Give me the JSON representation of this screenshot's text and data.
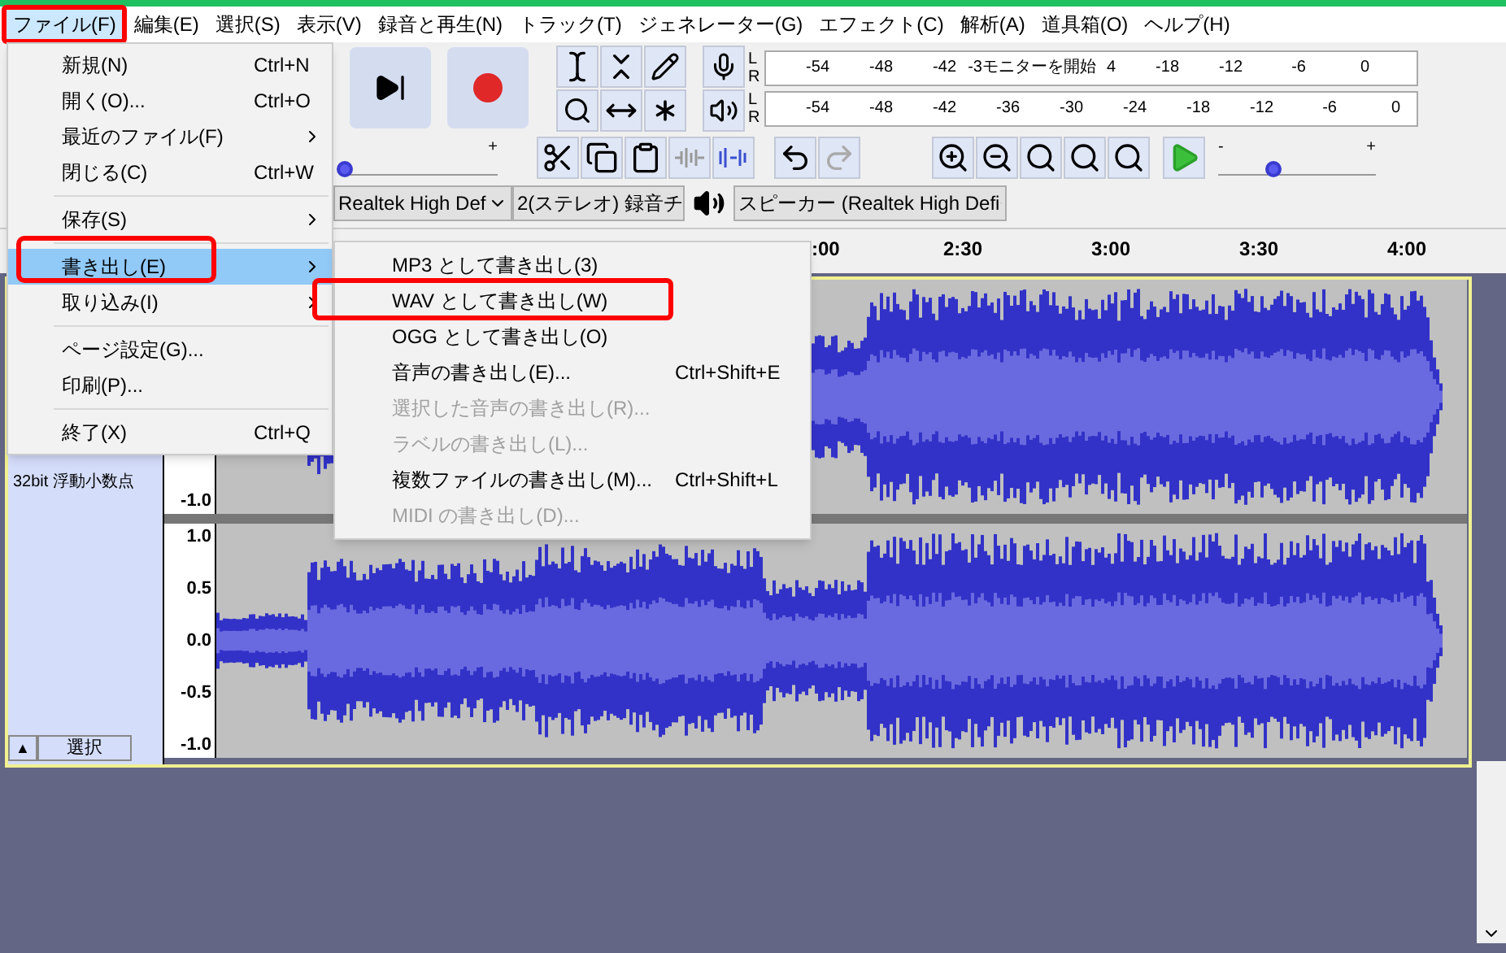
{
  "menubar": [
    {
      "label": "ファイル(F)",
      "selected": true,
      "annotated": true
    },
    {
      "label": "編集(E)",
      "selected": false,
      "annotated": false
    },
    {
      "label": "選択(S)",
      "selected": false,
      "annotated": false
    },
    {
      "label": "表示(V)",
      "selected": false,
      "annotated": false
    },
    {
      "label": "録音と再生(N)",
      "selected": false,
      "annotated": false
    },
    {
      "label": "トラック(T)",
      "selected": false,
      "annotated": false
    },
    {
      "label": "ジェネレーター(G)",
      "selected": false,
      "annotated": false
    },
    {
      "label": "エフェクト(C)",
      "selected": false,
      "annotated": false
    },
    {
      "label": "解析(A)",
      "selected": false,
      "annotated": false
    },
    {
      "label": "道具箱(O)",
      "selected": false,
      "annotated": false
    },
    {
      "label": "ヘルプ(H)",
      "selected": false,
      "annotated": false
    }
  ],
  "meters": [
    {
      "channels": [
        "L",
        "R"
      ],
      "ticks": [
        {
          "kind": "tick",
          "label": "-54"
        },
        {
          "kind": "tick",
          "label": "-48"
        },
        {
          "kind": "tick",
          "label": "-42"
        },
        {
          "kind": "stub",
          "label": "-3"
        },
        {
          "kind": "prompt",
          "label": "モニターを開始"
        },
        {
          "kind": "stub",
          "label": "4"
        },
        {
          "kind": "tick",
          "label": "-18"
        },
        {
          "kind": "tick",
          "label": "-12"
        },
        {
          "kind": "tick",
          "label": "-6"
        },
        {
          "kind": "tick",
          "label": "0"
        }
      ]
    },
    {
      "channels": [
        "L",
        "R"
      ],
      "ticks": [
        {
          "kind": "tick",
          "label": "-54"
        },
        {
          "kind": "tick",
          "label": "-48"
        },
        {
          "kind": "tick",
          "label": "-42"
        },
        {
          "kind": "tick",
          "label": "-36"
        },
        {
          "kind": "tick",
          "label": "-30"
        },
        {
          "kind": "tick",
          "label": "-24"
        },
        {
          "kind": "tick",
          "label": "-18"
        },
        {
          "kind": "tick",
          "label": "-12"
        },
        {
          "kind": "tick",
          "label": "-6"
        },
        {
          "kind": "tick",
          "label": "0"
        }
      ]
    }
  ],
  "volume_slider": {
    "plus": "+",
    "level": 0.03
  },
  "speed_slider": {
    "minus": "-",
    "plus": "+",
    "level": 0.35
  },
  "devices": {
    "host": "Realtek High Def",
    "channels": "2(ステレオ) 録音チ",
    "output": "スピーカー (Realtek High Defi"
  },
  "timeline": {
    "ticks": [
      ":00",
      "2:30",
      "3:00",
      "3:30",
      "4:00"
    ]
  },
  "track": {
    "format": "32bit 浮動小数点",
    "collapse": "▲",
    "select_button": "選択",
    "selected": true,
    "channels": [
      {
        "scale": [
          "-1.0"
        ]
      },
      {
        "scale": [
          "1.0",
          "0.5",
          "0.0",
          "-0.5",
          "-1.0"
        ]
      }
    ]
  },
  "file_menu": [
    {
      "kind": "item",
      "label": "新規(N)",
      "shortcut": "Ctrl+N",
      "submenu": false,
      "selected": false,
      "annotated": false
    },
    {
      "kind": "item",
      "label": "開く(O)...",
      "shortcut": "Ctrl+O",
      "submenu": false,
      "selected": false,
      "annotated": false
    },
    {
      "kind": "item",
      "label": "最近のファイル(F)",
      "submenu": true,
      "selected": false,
      "annotated": false
    },
    {
      "kind": "item",
      "label": "閉じる(C)",
      "shortcut": "Ctrl+W",
      "submenu": false,
      "selected": false,
      "annotated": false
    },
    {
      "kind": "separator"
    },
    {
      "kind": "item",
      "label": "保存(S)",
      "submenu": true,
      "selected": false,
      "annotated": false
    },
    {
      "kind": "separator"
    },
    {
      "kind": "item",
      "label": "書き出し(E)",
      "submenu": true,
      "selected": true,
      "annotated": true
    },
    {
      "kind": "item",
      "label": "取り込み(I)",
      "submenu": true,
      "selected": false,
      "annotated": false
    },
    {
      "kind": "separator"
    },
    {
      "kind": "item",
      "label": "ページ設定(G)...",
      "submenu": false,
      "selected": false,
      "annotated": false
    },
    {
      "kind": "item",
      "label": "印刷(P)...",
      "submenu": false,
      "selected": false,
      "annotated": false
    },
    {
      "kind": "separator"
    },
    {
      "kind": "item",
      "label": "終了(X)",
      "shortcut": "Ctrl+Q",
      "submenu": false,
      "selected": false,
      "annotated": false
    }
  ],
  "export_menu": [
    {
      "label": "MP3 として書き出し(3)",
      "disabled": false,
      "annotated": false
    },
    {
      "label": "WAV として書き出し(W)",
      "disabled": false,
      "annotated": true
    },
    {
      "label": "OGG として書き出し(O)",
      "disabled": false,
      "annotated": false
    },
    {
      "label": "音声の書き出し(E)...",
      "shortcut": "Ctrl+Shift+E",
      "disabled": false,
      "annotated": false
    },
    {
      "label": "選択した音声の書き出し(R)...",
      "disabled": true,
      "annotated": false
    },
    {
      "label": "ラベルの書き出し(L)...",
      "disabled": true,
      "annotated": false
    },
    {
      "label": "複数ファイルの書き出し(M)...",
      "shortcut": "Ctrl+Shift+L",
      "disabled": false,
      "annotated": false
    },
    {
      "label": "MIDI の書き出し(D)...",
      "disabled": true,
      "annotated": false
    }
  ]
}
